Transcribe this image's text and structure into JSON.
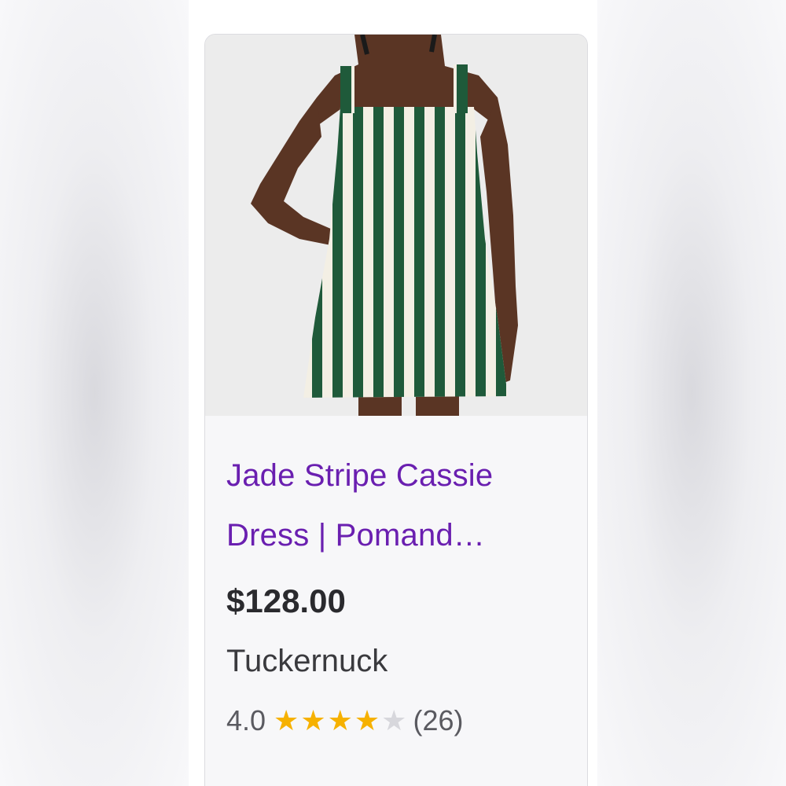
{
  "product": {
    "title_line1": "Jade Stripe Cassie",
    "title_line2": "Dress | Pomand…",
    "price": "$128.00",
    "merchant": "Tuckernuck",
    "rating": {
      "value": "4.0",
      "stars_filled": 4,
      "stars_total": 5,
      "count": "(26)"
    },
    "image_icon": "striped-dress-photo"
  },
  "colors": {
    "title": "#6a1fb0",
    "stripe_green": "#1f5a3a",
    "stripe_cream": "#f3efe4",
    "star": "#f6b100"
  }
}
